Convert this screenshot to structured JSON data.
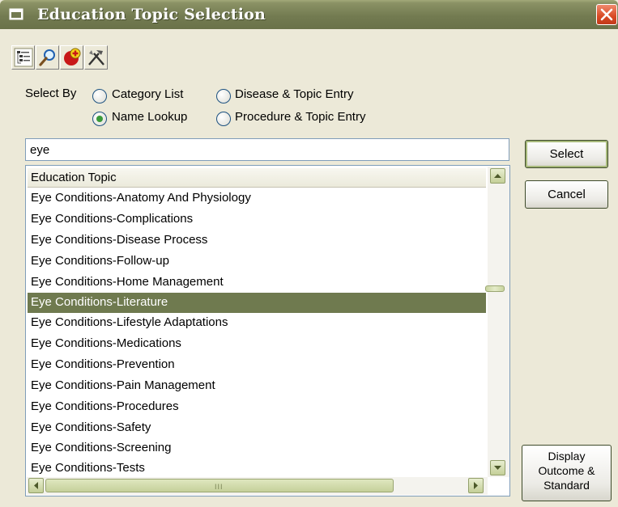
{
  "window": {
    "title": "Education Topic Selection"
  },
  "toolbar": {
    "buttons": [
      {
        "icon": "tree-list-icon"
      },
      {
        "icon": "magnifier-icon"
      },
      {
        "icon": "medical-add-icon"
      },
      {
        "icon": "tools-icon"
      }
    ]
  },
  "select_by": {
    "label": "Select By",
    "options": [
      {
        "label": "Category List",
        "checked": false
      },
      {
        "label": "Disease & Topic Entry",
        "checked": false
      },
      {
        "label": "Name Lookup",
        "checked": true
      },
      {
        "label": "Procedure & Topic Entry",
        "checked": false
      }
    ]
  },
  "search": {
    "value": "eye"
  },
  "list": {
    "header": "Education Topic",
    "items": [
      "Eye Conditions-Anatomy And Physiology",
      "Eye Conditions-Complications",
      "Eye Conditions-Disease Process",
      "Eye Conditions-Follow-up",
      "Eye Conditions-Home Management",
      "Eye Conditions-Literature",
      "Eye Conditions-Lifestyle Adaptations",
      "Eye Conditions-Medications",
      "Eye Conditions-Prevention",
      "Eye Conditions-Pain Management",
      "Eye Conditions-Procedures",
      "Eye Conditions-Safety",
      "Eye Conditions-Screening",
      "Eye Conditions-Tests"
    ],
    "selected": "Eye Conditions-Literature",
    "hscroll_grip": "III"
  },
  "buttons": {
    "select": "Select",
    "cancel": "Cancel",
    "display_line1": "Display",
    "display_line2": "Outcome &",
    "display_line3": "Standard"
  },
  "colors": {
    "titlebar": "#737b51",
    "selection": "#6f7a4f",
    "close": "#d84a24"
  }
}
